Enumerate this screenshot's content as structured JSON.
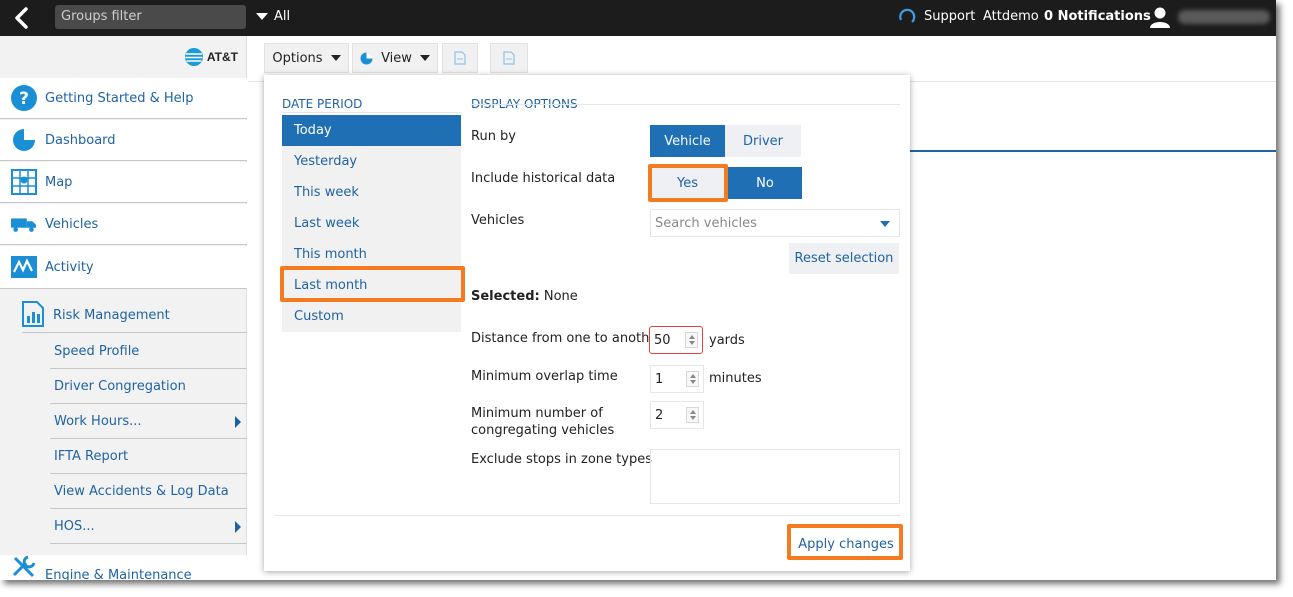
{
  "topbar": {
    "groups_placeholder": "Groups filter",
    "scope": "All",
    "support": "Support",
    "account": "Attdemo",
    "notifications": "0 Notifications"
  },
  "brand": {
    "logo_text": "AT&T"
  },
  "sidebar": {
    "items": [
      {
        "label": "Getting Started & Help",
        "icon": "help-icon"
      },
      {
        "label": "Dashboard",
        "icon": "pie-chart-icon"
      },
      {
        "label": "Map",
        "icon": "map-icon"
      },
      {
        "label": "Vehicles",
        "icon": "truck-icon"
      },
      {
        "label": "Activity",
        "icon": "activity-icon"
      }
    ],
    "risk": {
      "label": "Risk Management",
      "icon": "report-icon"
    },
    "sub_items": [
      {
        "label": "Speed Profile"
      },
      {
        "label": "Driver Congregation"
      },
      {
        "label": "Work Hours..."
      },
      {
        "label": "IFTA Report"
      },
      {
        "label": "View Accidents & Log Data"
      },
      {
        "label": "HOS..."
      }
    ],
    "bottom": {
      "label": "Engine & Maintenance",
      "icon": "wrench-icon"
    }
  },
  "toolbar": {
    "options": "Options",
    "view": "View"
  },
  "panel": {
    "date_period": {
      "title": "DATE PERIOD",
      "options": [
        "Today",
        "Yesterday",
        "This week",
        "Last week",
        "This month",
        "Last month",
        "Custom"
      ],
      "selected": "Today",
      "highlighted": "Last month"
    },
    "display": {
      "title": "DISPLAY OPTIONS",
      "run_by_label": "Run by",
      "run_by_vehicle": "Vehicle",
      "run_by_driver": "Driver",
      "historical_label": "Include historical data",
      "yes": "Yes",
      "no": "No",
      "vehicles_label": "Vehicles",
      "search_placeholder": "Search vehicles",
      "reset": "Reset selection",
      "selected_label": "Selected:",
      "selected_value": "None",
      "distance_label": "Distance from one to another",
      "distance_value": "50",
      "distance_unit": "yards",
      "overlap_label": "Minimum overlap time",
      "overlap_value": "1",
      "overlap_unit": "minutes",
      "min_vehicles_label_1": "Minimum number of",
      "min_vehicles_label_2": "congregating vehicles",
      "min_vehicles_value": "2",
      "exclude_label": "Exclude stops in zone types"
    },
    "apply": "Apply changes"
  },
  "colors": {
    "accent": "#1f6fb5",
    "link": "#1f63a3",
    "highlight": "#f47b20",
    "topbar": "#1c1c1c"
  }
}
